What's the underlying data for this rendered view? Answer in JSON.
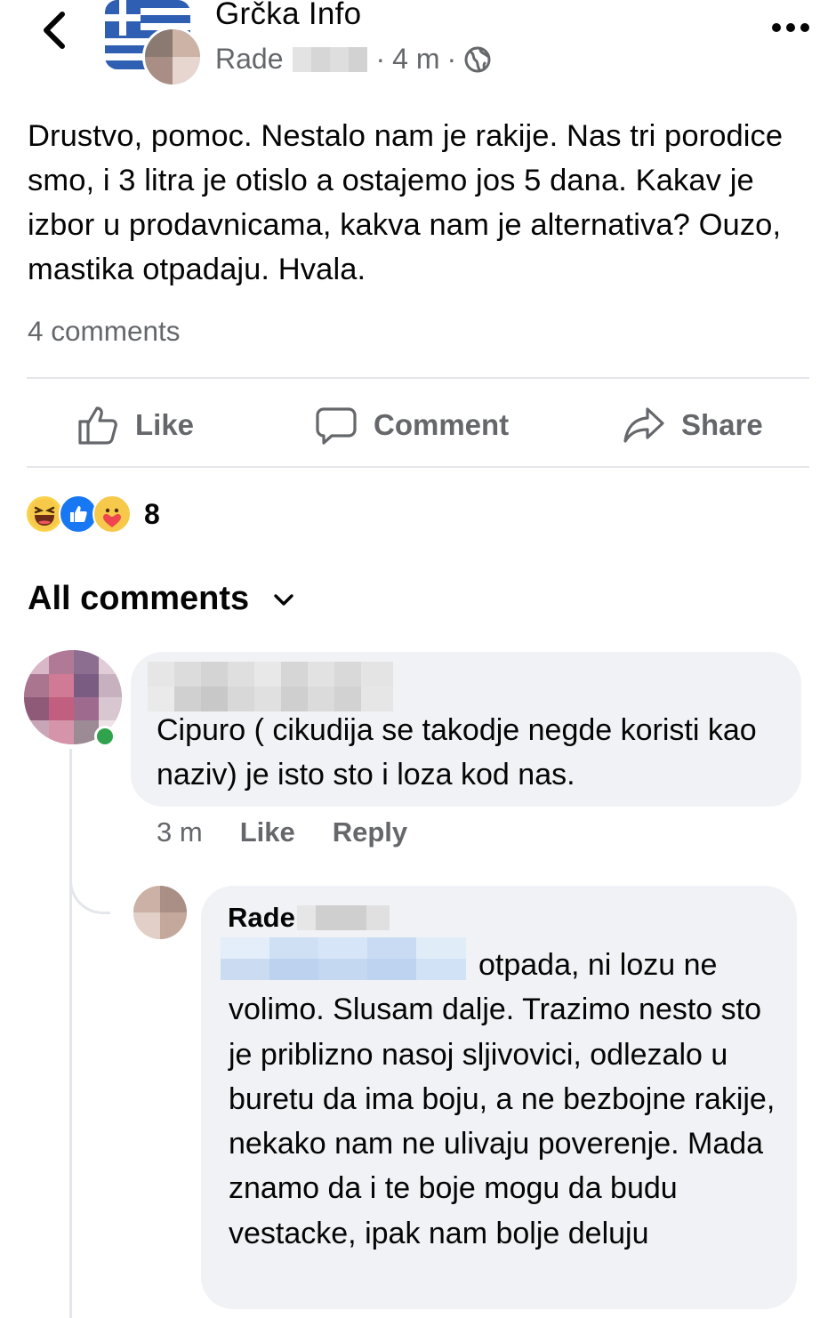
{
  "header": {
    "group_name": "Grčka Info",
    "author": "Rade",
    "time": "4 m",
    "separator": "·",
    "audience_icon": "globe-icon",
    "more_icon": "more-dots-icon",
    "back_icon": "chevron-left-icon"
  },
  "post": {
    "text": "Drustvo, pomoc. Nestalo nam je rakije. Nas tri porodice smo, i 3 litra je otislo a ostajemo jos 5 dana. Kakav je izbor u prodavnicama, kakva nam je alternativa? Ouzo, mastika otpadaju. Hvala.",
    "comment_count": "4 comments"
  },
  "actions": {
    "like_label": "Like",
    "comment_label": "Comment",
    "share_label": "Share"
  },
  "reactions": {
    "icons": [
      "haha-icon",
      "like-icon",
      "care-icon"
    ],
    "count": "8"
  },
  "comments_section": {
    "title": "All comments"
  },
  "comments": [
    {
      "text": "Cipuro ( cikudija se takodje negde koristi kao naziv) je isto sto i loza kod nas.",
      "time": "3 m",
      "like_label": "Like",
      "reply_label": "Reply"
    },
    {
      "author": "Rade",
      "text": "otpada, ni lozu ne volimo. Slusam dalje. Trazimo nesto sto je priblizno nasoj sljivovici, odlezalo u buretu da ima boju, a ne bezbojne rakije, nekako nam ne ulivaju poverenje. Mada znamo da i te boje mogu da budu vestacke, ipak nam bolje deluju"
    }
  ],
  "colors": {
    "text": "#050505",
    "secondary": "#65676b",
    "bubble": "#f0f2f5",
    "divider": "#e4e6eb",
    "like_blue": "#1877f2",
    "online": "#31a24c"
  }
}
